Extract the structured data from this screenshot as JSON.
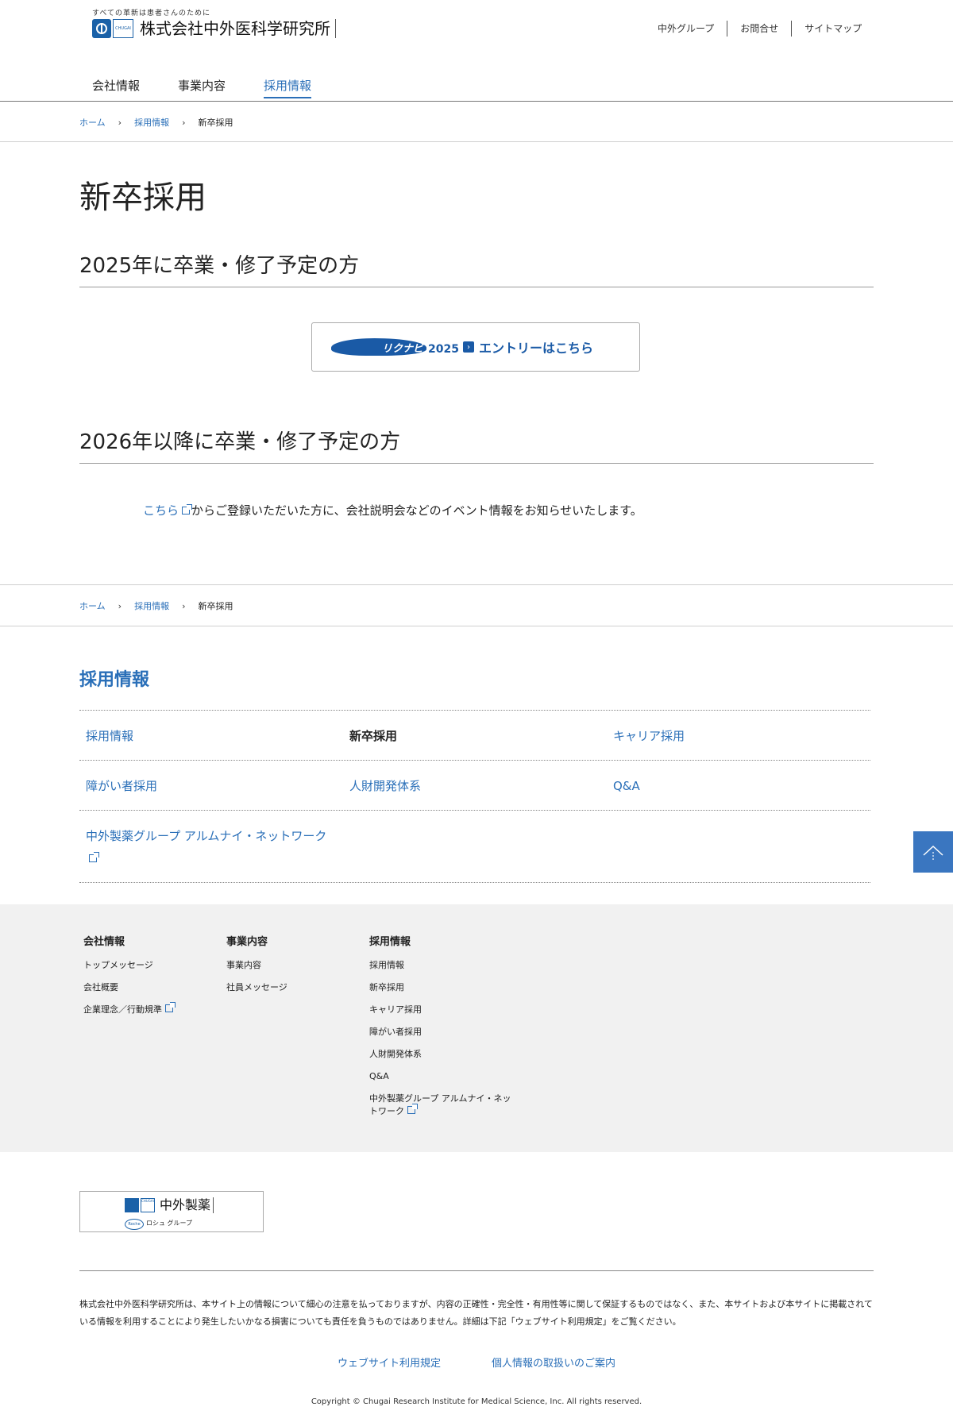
{
  "header": {
    "tagline": "すべての革新は患者さんのために",
    "logo_sub": "CHUGAI",
    "company_name": "株式会社中外医科学研究所",
    "utility_links": [
      "中外グループ",
      "お問合せ",
      "サイトマップ"
    ],
    "nav": [
      {
        "label": "会社情報",
        "active": false
      },
      {
        "label": "事業内容",
        "active": false
      },
      {
        "label": "採用情報",
        "active": true
      }
    ]
  },
  "breadcrumb": {
    "home": "ホーム",
    "parent": "採用情報",
    "current": "新卒採用",
    "separator": "›"
  },
  "main": {
    "page_title": "新卒採用",
    "section1": {
      "heading": "2025年に卒業・修了予定の方",
      "banner": {
        "logo_text": "リクナビ",
        "logo_year": "2025",
        "arrow": "›",
        "label": "エントリーはこちら"
      }
    },
    "section2": {
      "heading": "2026年以降に卒業・修了予定の方",
      "link_text": "こちら",
      "text": "からご登録いただいた方に、会社説明会などのイベント情報をお知らせいたします。"
    }
  },
  "recruit_menu": {
    "heading": "採用情報",
    "rows": [
      [
        {
          "label": "採用情報",
          "current": false
        },
        {
          "label": "新卒採用",
          "current": true
        },
        {
          "label": "キャリア採用",
          "current": false
        }
      ],
      [
        {
          "label": "障がい者採用",
          "current": false
        },
        {
          "label": "人財開発体系",
          "current": false
        },
        {
          "label": "Q&A",
          "current": false
        }
      ],
      [
        {
          "label": "中外製薬グループ アルムナイ・ネットワーク",
          "current": false,
          "external": true
        }
      ]
    ]
  },
  "footer_nav": {
    "columns": [
      {
        "heading": "会社情報",
        "links": [
          "トップメッセージ",
          "会社概要",
          "企業理念／行動規準"
        ]
      },
      {
        "heading": "事業内容",
        "links": [
          "事業内容",
          "社員メッセージ"
        ]
      },
      {
        "heading": "採用情報",
        "links": [
          "採用情報",
          "新卒採用",
          "キャリア採用",
          "障がい者採用",
          "人財開発体系",
          "Q&A",
          "中外製薬グループ アルムナイ・ネットワーク"
        ]
      }
    ]
  },
  "footer": {
    "logo_sub": "CHUGAI",
    "logo_name": "中外製薬",
    "roche_badge": "Roche",
    "roche_group": "ロシュ グループ",
    "disclaimer": "株式会社中外医科学研究所は、本サイト上の情報について細心の注意を払っておりますが、内容の正確性・完全性・有用性等に関して保証するものではなく、また、本サイトおよび本サイトに掲載されている情報を利用することにより発生したいかなる損害についても責任を負うものではありません。詳細は下記「ウェブサイト利用規定」をご覧ください。",
    "links": [
      "ウェブサイト利用規定",
      "個人情報の取扱いのご案内"
    ],
    "copyright": "Copyright © Chugai Research Institute for Medical Science, Inc. All rights reserved."
  },
  "colors": {
    "link": "#2a6fb8",
    "brand": "#1a61a8",
    "pagetop": "#3a76c0",
    "footer_bg": "#f1f1f1"
  }
}
